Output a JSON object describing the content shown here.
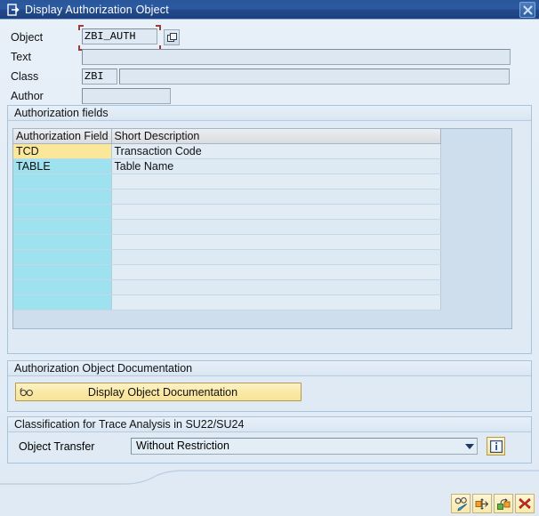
{
  "window": {
    "title": "Display Authorization Object",
    "icon": "window-arrow-icon",
    "close_label": "✖",
    "titlebar_color": "#2a5699"
  },
  "form": {
    "fields": [
      {
        "label": "Object",
        "value": "ZBI_AUTH",
        "focused": true,
        "has_value_help": true
      },
      {
        "label": "Text",
        "value": "",
        "focused": false,
        "has_value_help": false
      },
      {
        "label": "Class",
        "value": "ZBI",
        "value2": "",
        "focused": false,
        "has_value_help": false
      },
      {
        "label": "Author",
        "value": "",
        "focused": false,
        "has_value_help": false
      }
    ]
  },
  "auth_fields_group": {
    "title": "Authorization fields",
    "columns": [
      "Authorization Field",
      "Short Description"
    ],
    "rows": [
      {
        "field": "TCD",
        "description": "Transaction Code",
        "selected": true
      },
      {
        "field": "TABLE",
        "description": "Table Name",
        "selected": false
      },
      {
        "field": "",
        "description": "",
        "selected": false
      },
      {
        "field": "",
        "description": "",
        "selected": false
      },
      {
        "field": "",
        "description": "",
        "selected": false
      },
      {
        "field": "",
        "description": "",
        "selected": false
      },
      {
        "field": "",
        "description": "",
        "selected": false
      },
      {
        "field": "",
        "description": "",
        "selected": false
      },
      {
        "field": "",
        "description": "",
        "selected": false
      },
      {
        "field": "",
        "description": "",
        "selected": false
      },
      {
        "field": "",
        "description": "",
        "selected": false
      }
    ],
    "selected_row_color": "#fbe79a",
    "field_column_color": "#9fe2ef"
  },
  "documentation_group": {
    "title": "Authorization Object Documentation",
    "button_label": "Display Object Documentation",
    "button_icon": "glasses-icon"
  },
  "classification_group": {
    "title": "Classification for Trace Analysis in SU22/SU24",
    "label": "Object Transfer",
    "selected_option": "Without Restriction",
    "options": [
      "Without Restriction"
    ],
    "info_icon": "info-icon"
  },
  "toolbar": {
    "buttons": [
      {
        "name": "display-change-button",
        "icon": "glasses-pencil-icon",
        "tooltip": "Display <-> Change"
      },
      {
        "name": "where-used-button",
        "icon": "where-used-icon",
        "tooltip": "Where-Used List"
      },
      {
        "name": "other-object-button",
        "icon": "other-object-icon",
        "tooltip": "Other Object"
      },
      {
        "name": "cancel-button",
        "icon": "red-x-icon",
        "tooltip": "Cancel"
      }
    ]
  }
}
